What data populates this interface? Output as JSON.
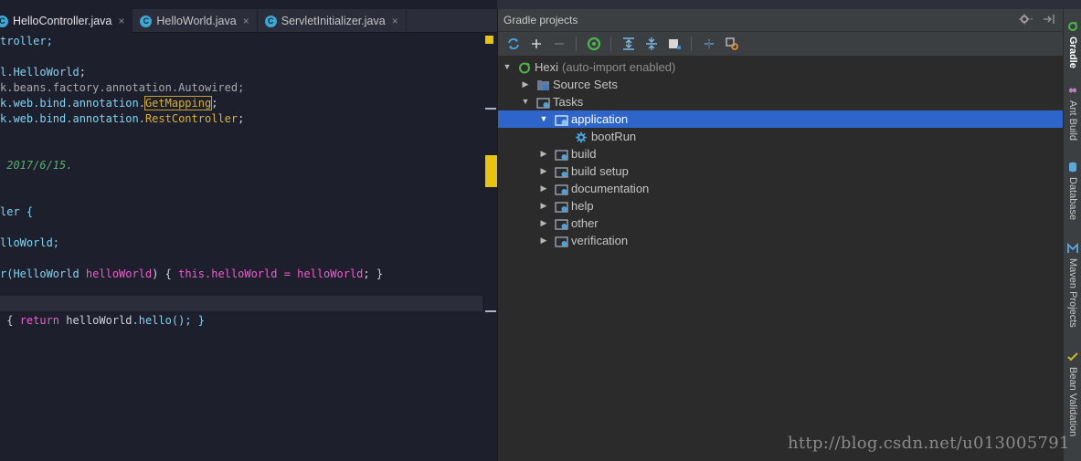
{
  "editor": {
    "tabs": [
      {
        "label": "HelloController.java",
        "icon": "c-class-icon",
        "active": true
      },
      {
        "label": "HelloWorld.java",
        "icon": "c-class-icon",
        "active": false
      },
      {
        "label": "ServletInitializer.java",
        "icon": "c-class-icon",
        "active": false
      }
    ],
    "close_glyph": "×",
    "code": {
      "l1": "troller;",
      "l2a": "l.",
      "l2b": "HelloWorld",
      "l2c": ";",
      "l3": "k.beans.factory.annotation.Autowired;",
      "l4a": "k.web.bind.annotation.",
      "l4b": "GetMapping",
      "l4c": ";",
      "l5a": "k.web.bind.annotation.",
      "l5b": "RestController",
      "l5c": ";",
      "l6": " 2017/6/15.",
      "l7": "ler {",
      "l8": "lloWorld;",
      "l9a": "r(",
      "l9b": "HelloWorld",
      "l9c": " helloWorld",
      "l9d": ") { ",
      "l9e": "this",
      "l9f": ".helloWorld = ",
      "l9g": "helloWorld",
      "l9h": "; }",
      "l10a": " { ",
      "l10b": "return",
      "l10c": " helloWorld",
      "l10d": ".hello(); }"
    }
  },
  "gradle": {
    "title": "Gradle projects",
    "header_controls": [
      "gear-icon",
      "pin-icon"
    ],
    "toolbar": [
      "refresh-icon",
      "add-icon",
      "remove-icon",
      "execute-task-icon",
      "expand-all-icon",
      "collapse-all-icon",
      "stop-icon",
      "link-icon",
      "settings-wrench-icon"
    ],
    "tree": {
      "root_name": "Hexi",
      "root_note": "(auto-import enabled)",
      "source_sets": "Source Sets",
      "tasks": "Tasks",
      "application": "application",
      "bootrun": "bootRun",
      "groups": [
        "build",
        "build setup",
        "documentation",
        "help",
        "other",
        "verification"
      ]
    }
  },
  "side_tabs": [
    "Gradle",
    "Ant Build",
    "Database",
    "Maven Projects",
    "Bean Validation"
  ],
  "watermark": "http://blog.csdn.net/u013005791",
  "colors": {
    "selection": "#2e65ca",
    "accent_marker": "#e9c40f",
    "gradle_green": "#4bb64a"
  }
}
